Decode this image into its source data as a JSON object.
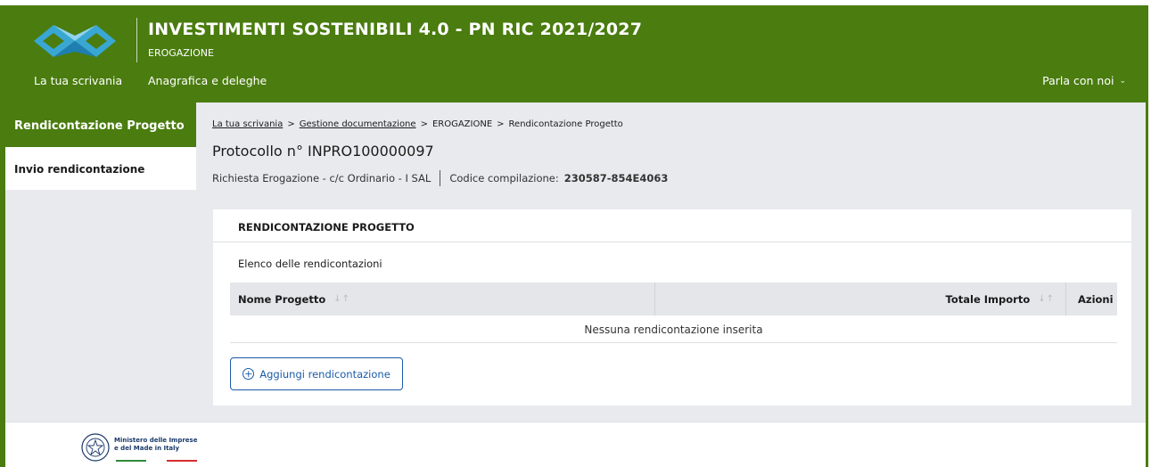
{
  "header": {
    "title": "INVESTIMENTI SOSTENIBILI 4.0 - PN RIC 2021/2027",
    "subtitle": "EROGAZIONE",
    "nav": [
      "La tua scrivania",
      "Anagrafica e deleghe"
    ],
    "contact": "Parla con noi"
  },
  "sidebar": {
    "items": [
      {
        "label": "Rendicontazione Progetto",
        "active": true
      },
      {
        "label": "Invio rendicontazione",
        "active": false
      }
    ]
  },
  "breadcrumb": {
    "items": [
      "La tua scrivania",
      "Gestione documentazione",
      "EROGAZIONE",
      "Rendicontazione Progetto"
    ],
    "separator": ">"
  },
  "page": {
    "protocollo": "Protocollo n° INPRO100000097",
    "richiesta": "Richiesta Erogazione - c/c Ordinario - I SAL",
    "codice_label": "Codice compilazione:",
    "codice_value": "230587-854E4063"
  },
  "card": {
    "title": "RENDICONTAZIONE PROGETTO",
    "list_title": "Elenco delle rendicontazioni",
    "columns": [
      "Nome Progetto",
      "Totale Importo",
      "Azioni"
    ],
    "empty_message": "Nessuna rendicontazione inserita",
    "add_button": "Aggiungi rendicontazione"
  },
  "footer": {
    "ministry_line1": "Ministero delle Imprese",
    "ministry_line2": "e del Made in Italy"
  },
  "colors": {
    "brand_green": "#4a7c0f",
    "link_blue": "#1b5ba8",
    "panel_gray": "#e8eaed"
  },
  "icons": [
    "logo-icon",
    "chevron-down-icon",
    "sort-icon",
    "plus-circle-icon",
    "emblem-icon"
  ]
}
